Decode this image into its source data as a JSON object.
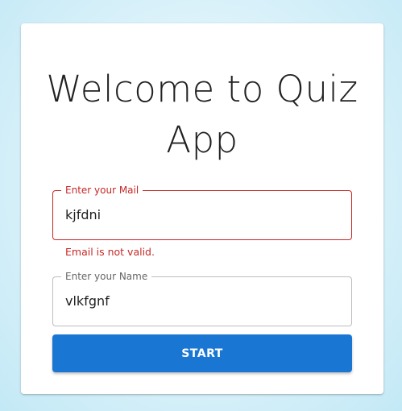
{
  "page": {
    "title": "Welcome to Quiz App"
  },
  "form": {
    "email": {
      "label": "Enter your Mail",
      "value": "kjfdni",
      "error": "Email is not valid."
    },
    "name": {
      "label": "Enter your Name",
      "value": "vlkfgnf"
    },
    "start_label": "START"
  },
  "colors": {
    "primary": "#1976d2",
    "error": "#c62828",
    "background": "#c3e9f6"
  }
}
